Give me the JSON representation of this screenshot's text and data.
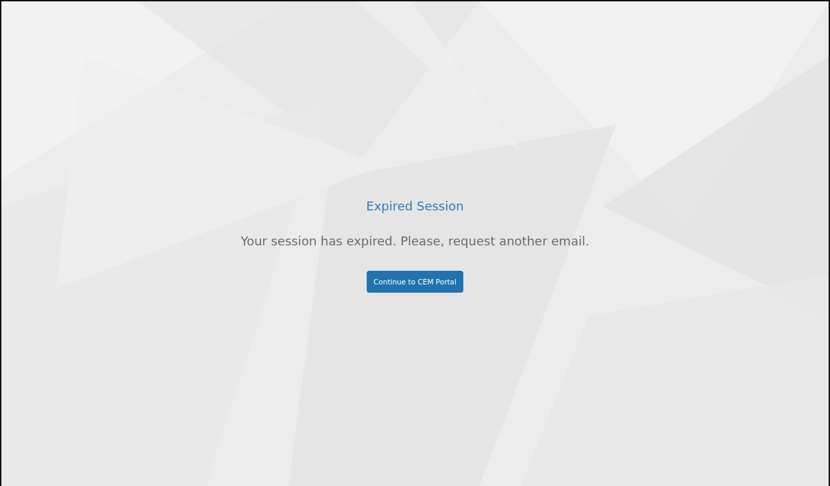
{
  "title": "Expired Session",
  "message": "Your session has expired. Please, request another email.",
  "button": {
    "label": "Continue to CEM Portal"
  }
}
